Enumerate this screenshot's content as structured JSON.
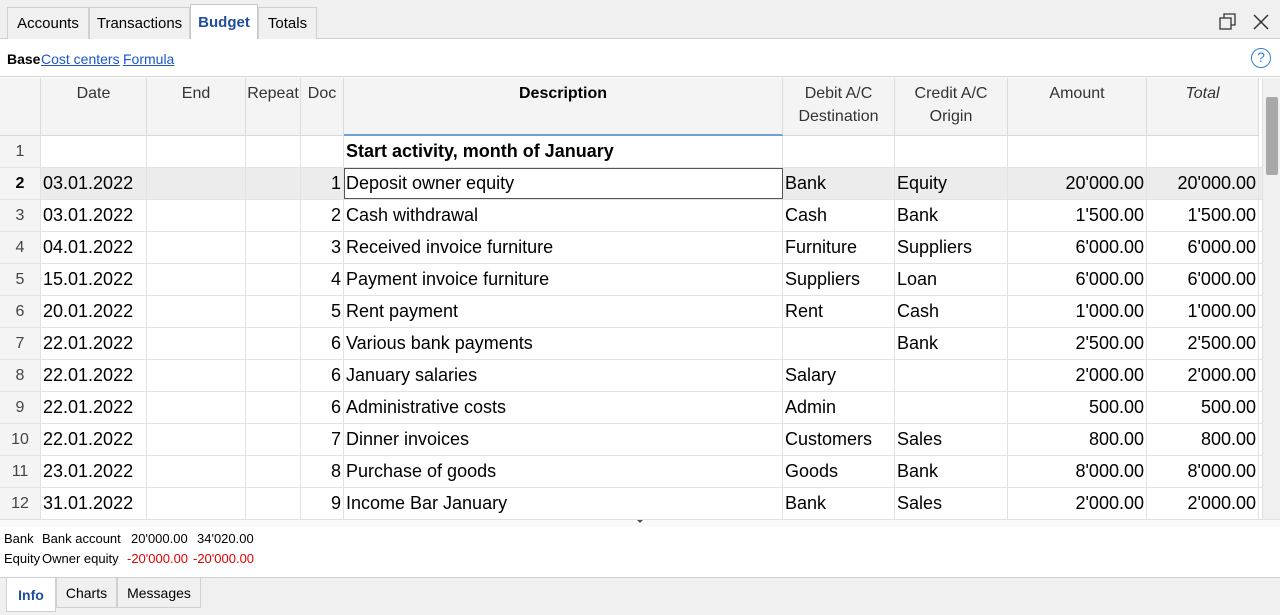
{
  "tabs": [
    "Accounts",
    "Transactions",
    "Budget",
    "Totals"
  ],
  "active_tab": "Budget",
  "subnav": {
    "base": "Base",
    "cost_centers": "Cost centers",
    "formula": "Formula"
  },
  "help_glyph": "?",
  "columns": {
    "date": "Date",
    "end": "End",
    "repeat": "Repeat",
    "doc": "Doc",
    "description": "Description",
    "debit_line1": "Debit A/C",
    "debit_line2": "Destination",
    "credit_line1": "Credit A/C",
    "credit_line2": "Origin",
    "amount": "Amount",
    "total": "Total"
  },
  "rows": [
    {
      "n": "1",
      "date": "",
      "end": "",
      "repeat": "",
      "doc": "",
      "description": "Start activity, month of January",
      "debit": "",
      "credit": "",
      "amount": "",
      "total": ""
    },
    {
      "n": "2",
      "date": "03.01.2022",
      "end": "",
      "repeat": "",
      "doc": "1",
      "description": "Deposit owner equity",
      "debit": "Bank",
      "credit": "Equity",
      "amount": "20'000.00",
      "total": "20'000.00"
    },
    {
      "n": "3",
      "date": "03.01.2022",
      "end": "",
      "repeat": "",
      "doc": "2",
      "description": "Cash withdrawal",
      "debit": "Cash",
      "credit": "Bank",
      "amount": "1'500.00",
      "total": "1'500.00"
    },
    {
      "n": "4",
      "date": "04.01.2022",
      "end": "",
      "repeat": "",
      "doc": "3",
      "description": "Received invoice furniture",
      "debit": "Furniture",
      "credit": "Suppliers",
      "amount": "6'000.00",
      "total": "6'000.00"
    },
    {
      "n": "5",
      "date": "15.01.2022",
      "end": "",
      "repeat": "",
      "doc": "4",
      "description": "Payment invoice furniture",
      "debit": "Suppliers",
      "credit": "Loan",
      "amount": "6'000.00",
      "total": "6'000.00"
    },
    {
      "n": "6",
      "date": "20.01.2022",
      "end": "",
      "repeat": "",
      "doc": "5",
      "description": "Rent payment",
      "debit": "Rent",
      "credit": "Cash",
      "amount": "1'000.00",
      "total": "1'000.00"
    },
    {
      "n": "7",
      "date": "22.01.2022",
      "end": "",
      "repeat": "",
      "doc": "6",
      "description": "Various bank payments",
      "debit": "",
      "credit": "Bank",
      "amount": "2'500.00",
      "total": "2'500.00"
    },
    {
      "n": "8",
      "date": "22.01.2022",
      "end": "",
      "repeat": "",
      "doc": "6",
      "description": "January salaries",
      "debit": "Salary",
      "credit": "",
      "amount": "2'000.00",
      "total": "2'000.00"
    },
    {
      "n": "9",
      "date": "22.01.2022",
      "end": "",
      "repeat": "",
      "doc": "6",
      "description": "Administrative costs",
      "debit": "Admin",
      "credit": "",
      "amount": "500.00",
      "total": "500.00"
    },
    {
      "n": "10",
      "date": "22.01.2022",
      "end": "",
      "repeat": "",
      "doc": "7",
      "description": "Dinner invoices",
      "debit": "Customers",
      "credit": "Sales",
      "amount": "800.00",
      "total": "800.00"
    },
    {
      "n": "11",
      "date": "23.01.2022",
      "end": "",
      "repeat": "",
      "doc": "8",
      "description": "Purchase of goods",
      "debit": "Goods",
      "credit": "Bank",
      "amount": "8'000.00",
      "total": "8'000.00"
    },
    {
      "n": "12",
      "date": "31.01.2022",
      "end": "",
      "repeat": "",
      "doc": "9",
      "description": "Income Bar January",
      "debit": "Bank",
      "credit": "Sales",
      "amount": "2'000.00",
      "total": "2'000.00"
    }
  ],
  "selected_row": "2",
  "info": {
    "line1": {
      "account": "Bank",
      "name": "Bank account",
      "value1": "20'000.00",
      "value2": "34'020.00"
    },
    "line2": {
      "account": "Equity",
      "name": "Owner equity",
      "value1": "-20'000.00",
      "value2": "-20'000.00"
    }
  },
  "bottom_tabs": [
    "Info",
    "Charts",
    "Messages"
  ],
  "active_bottom_tab": "Info",
  "colors": {
    "accent": "#1f4e9c",
    "link": "#1a56c8",
    "negative": "#e00000",
    "help": "#2f7fd6"
  },
  "icons": {
    "restore": "restore-window-icon",
    "close": "close-icon",
    "help": "help-icon"
  }
}
